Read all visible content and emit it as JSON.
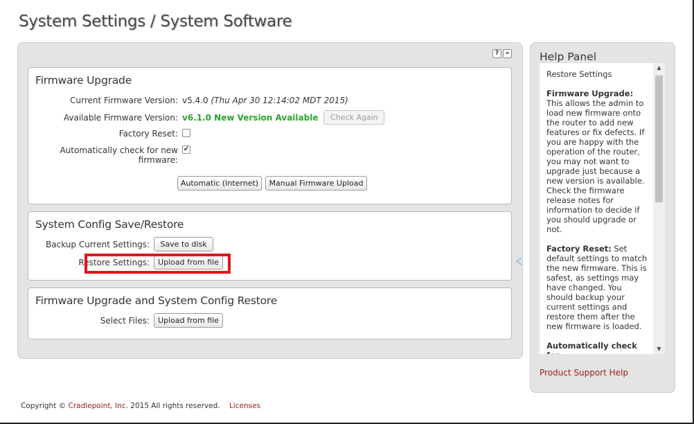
{
  "page": {
    "title": "System Settings / System Software"
  },
  "tools": {
    "help": "?",
    "expand": "»"
  },
  "firmware": {
    "title": "Firmware Upgrade",
    "current_label": "Current Firmware Version:",
    "current_version": "v5.4.0",
    "current_date": "(Thu Apr 30 12:14:02 MDT 2015)",
    "available_label": "Available Firmware Version:",
    "available_value": "v6.1.0 New Version Available",
    "check_again": "Check Again",
    "factory_reset_label": "Factory Reset:",
    "factory_reset_checked": false,
    "auto_check_label_1": "Automatically check for new",
    "auto_check_label_2": "firmware:",
    "auto_check_checked": true,
    "automatic_button": "Automatic (Internet)",
    "manual_button": "Manual Firmware Upload"
  },
  "config": {
    "title": "System Config Save/Restore",
    "backup_label": "Backup Current Settings:",
    "backup_button": "Save to disk",
    "restore_label": "Restore Settings:",
    "restore_button": "Upload from file"
  },
  "combined": {
    "title": "Firmware Upgrade and System Config Restore",
    "select_label": "Select Files:",
    "upload_button": "Upload from file"
  },
  "help": {
    "title": "Help Panel",
    "heading": "Restore Settings",
    "p1_term": "Firmware Upgrade:",
    "p1_text": " This allows the admin to load new firmware onto the router to add new features or fix defects. If you are happy with the operation of the router, you may not want to upgrade just because a new version is available. Check the firmware release notes for information to decide if you should upgrade or not.",
    "p2_term": "Factory Reset:",
    "p2_text": " Set default settings to match the new firmware. This is safest, as settings may have changed. You should backup your current settings and restore them after the new firmware is loaded.",
    "p3_term": "Automatically check for",
    "support_link": "Product Support Help"
  },
  "footer": {
    "copyright_prefix": "Copyright © ",
    "company": "Cradlepoint, Inc.",
    "copyright_suffix": " 2015 All rights reserved.",
    "licenses": "Licenses"
  }
}
